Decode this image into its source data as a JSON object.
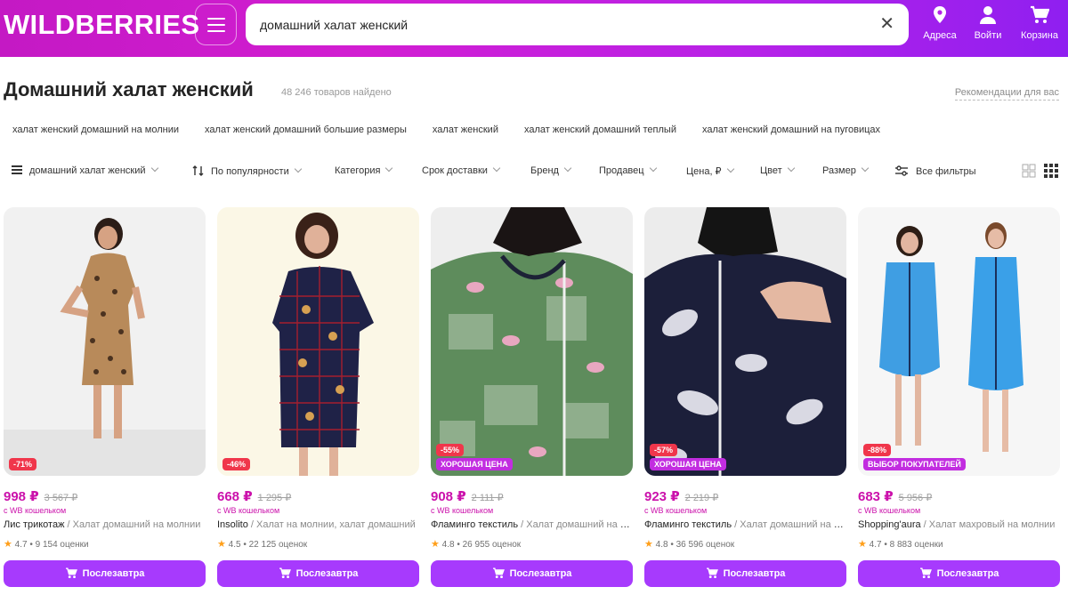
{
  "header": {
    "logo": "WILDBERRIES",
    "search_value": "домашний халат женский",
    "address_label": "Адреса",
    "login_label": "Войти",
    "cart_label": "Корзина"
  },
  "page": {
    "title": "Домашний халат женский",
    "count": "48 246 товаров найдено",
    "recommendations": "Рекомендации для вас"
  },
  "suggestions": [
    "халат женский домашний на молнии",
    "халат женский домашний большие размеры",
    "халат женский",
    "халат женский домашний теплый",
    "халат женский домашний на пуговицах"
  ],
  "filters": {
    "query": "домашний халат женский",
    "sort": "По популярности",
    "category": "Категория",
    "delivery": "Срок доставки",
    "brand": "Бренд",
    "seller": "Продавец",
    "price": "Цена, ₽",
    "color": "Цвет",
    "size": "Размер",
    "all": "Все фильтры"
  },
  "products": [
    {
      "discount": "-71%",
      "tag": "",
      "price": "998 ₽",
      "old_price": "3 567 ₽",
      "wallet": "с WB кошельком",
      "brand": "Лис трикотаж",
      "title": " / Халат домашний на молнии",
      "rating": "4.7",
      "reviews": " • 9 154 оценки",
      "buy": "Послезавтра"
    },
    {
      "discount": "-46%",
      "tag": "",
      "price": "668 ₽",
      "old_price": "1 295 ₽",
      "wallet": "с WB кошельком",
      "brand": "Insolito",
      "title": " / Халат на молнии, халат домашний",
      "rating": "4.5",
      "reviews": " • 22 125 оценок",
      "buy": "Послезавтра"
    },
    {
      "discount": "-55%",
      "tag": "ХОРОШАЯ ЦЕНА",
      "price": "908 ₽",
      "old_price": "2 111 ₽",
      "wallet": "с WB кошельком",
      "brand": "Фламинго текстиль",
      "title": " / Халат домашний на молнии",
      "rating": "4.8",
      "reviews": " • 26 955 оценок",
      "buy": "Послезавтра"
    },
    {
      "discount": "-57%",
      "tag": "ХОРОШАЯ ЦЕНА",
      "price": "923 ₽",
      "old_price": "2 219 ₽",
      "wallet": "с WB кошельком",
      "brand": "Фламинго текстиль",
      "title": " / Халат домашний на молнии",
      "rating": "4.8",
      "reviews": " • 36 596 оценок",
      "buy": "Послезавтра"
    },
    {
      "discount": "-88%",
      "tag": "ВЫБОР ПОКУПАТЕЛЕЙ",
      "price": "683 ₽",
      "old_price": "5 956 ₽",
      "wallet": "с WB кошельком",
      "brand": "Shopping'aura",
      "title": " / Халат махровый на молнии",
      "rating": "4.7",
      "reviews": " • 8 883 оценки",
      "buy": "Послезавтра"
    }
  ],
  "colors": {
    "accent": "#cb11ab",
    "buy_button": "#a73afd",
    "discount_badge": "#f0364b",
    "tag_badge": "#c22de0"
  }
}
